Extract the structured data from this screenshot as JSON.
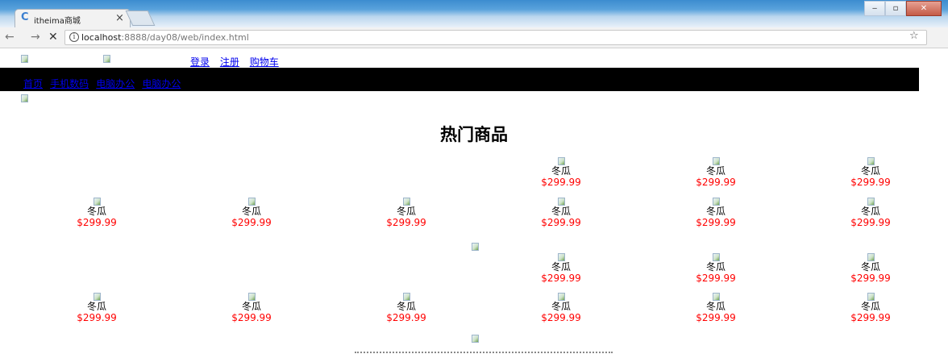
{
  "browser": {
    "tab": {
      "title": "itheima商城",
      "close": "×",
      "favicon": "C"
    },
    "nav": {
      "back": "←",
      "forward": "→",
      "reload": "✕"
    },
    "address": {
      "info": "i",
      "host": "localhost",
      "rest": ":8888/day08/web/index.html"
    },
    "star": "☆",
    "window": {
      "minimize": "‒",
      "maximize": "▫",
      "close": "✕"
    }
  },
  "header": {
    "links": [
      "登录",
      "注册",
      "购物车"
    ]
  },
  "menu": {
    "items": [
      "首页",
      "手机数码",
      "电脑办公",
      "电脑办公"
    ]
  },
  "hot": {
    "title": "热门商品"
  },
  "product": {
    "name": "冬瓜",
    "price": "$299.99"
  }
}
